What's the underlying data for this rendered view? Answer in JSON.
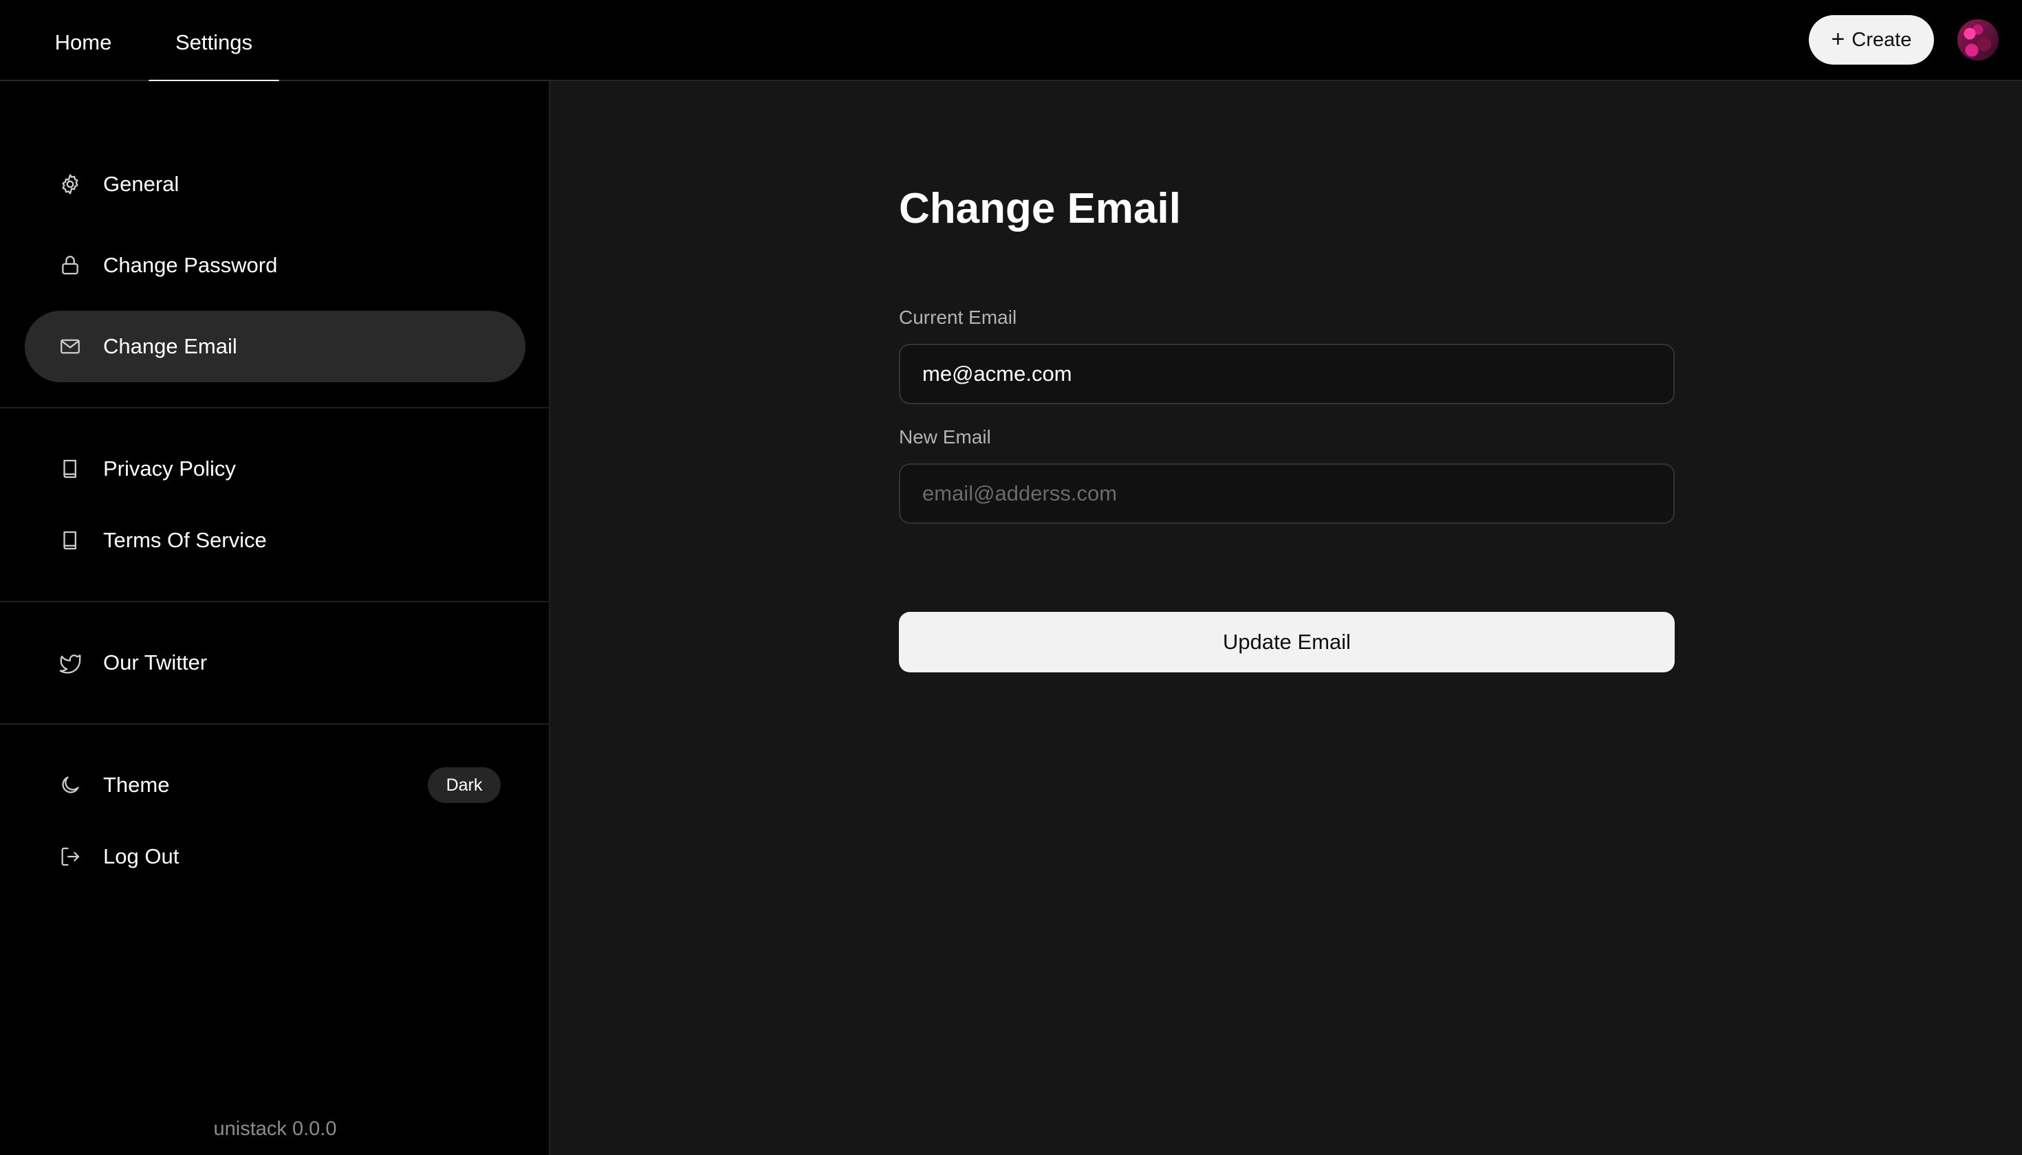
{
  "topbar": {
    "tabs": [
      {
        "label": "Home"
      },
      {
        "label": "Settings",
        "active": true
      }
    ],
    "create_button": {
      "icon": "plus-icon",
      "label": "Create"
    },
    "avatar": {
      "icon": "avatar"
    }
  },
  "sidebar": {
    "groups": [
      [
        {
          "label": "General",
          "icon": "gear-icon"
        },
        {
          "label": "Change Password",
          "icon": "lock-icon"
        },
        {
          "label": "Change Email",
          "icon": "mail-icon",
          "active": true
        }
      ],
      [
        {
          "label": "Privacy Policy",
          "icon": "book-icon"
        },
        {
          "label": "Terms Of Service",
          "icon": "book-icon"
        }
      ],
      [
        {
          "label": "Our Twitter",
          "icon": "twitter-icon"
        }
      ],
      [
        {
          "label": "Theme",
          "icon": "moon-icon",
          "badge": "Dark"
        },
        {
          "label": "Log Out",
          "icon": "logout-icon"
        }
      ]
    ],
    "version": "unistack 0.0.0"
  },
  "main": {
    "title": "Change Email",
    "current_email": {
      "label": "Current Email",
      "value": "me@acme.com"
    },
    "new_email": {
      "label": "New Email",
      "placeholder": "email@adderss.com",
      "value": ""
    },
    "submit_label": "Update Email"
  },
  "colors": {
    "background": "#000000",
    "panel": "#161616",
    "active_item": "#2a2a2a",
    "button": "#f2f2f2"
  }
}
